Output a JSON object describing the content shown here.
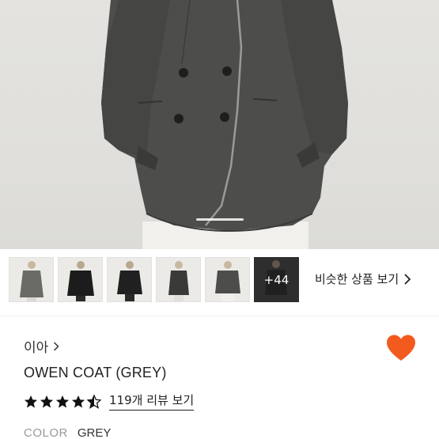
{
  "thumbnails": {
    "more_count": "+44",
    "similar_label": "비슷한 상품 보기"
  },
  "product": {
    "brand": "이아",
    "title": "OWEN COAT (GREY)",
    "rating": 4.5,
    "review_link": "119개 리뷰 보기",
    "color_label": "COLOR",
    "color_value": "GREY",
    "wishlisted": true
  },
  "colors": {
    "accent": "#f25a1e",
    "coat": "#4a4a48"
  }
}
